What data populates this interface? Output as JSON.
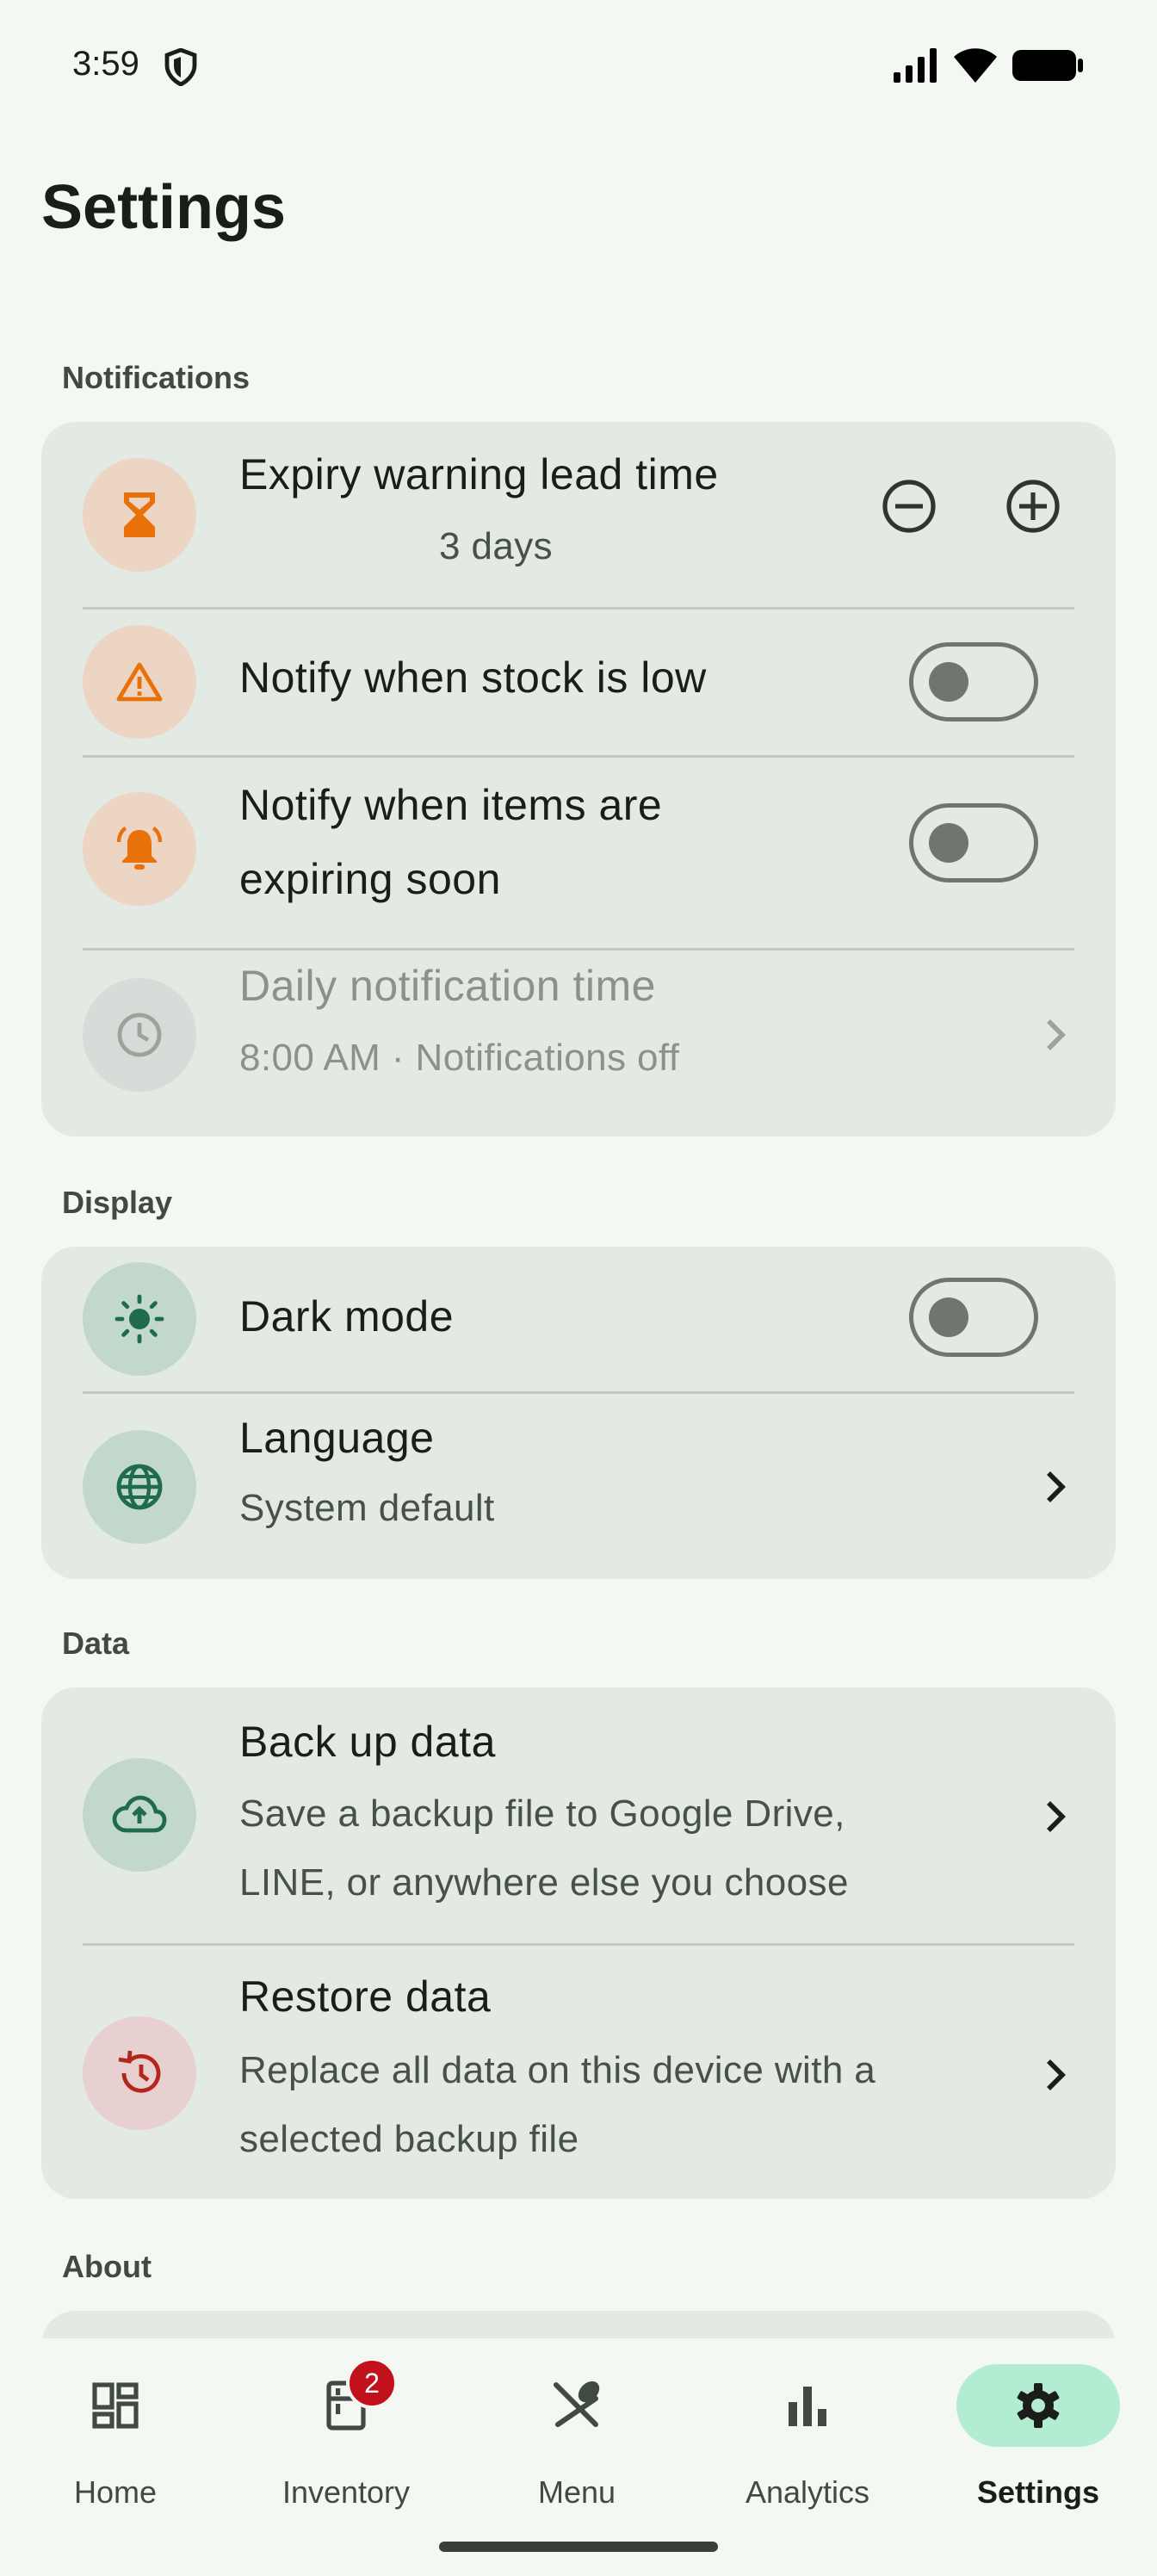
{
  "status": {
    "time": "3:59"
  },
  "page": {
    "title": "Settings"
  },
  "sections": {
    "notifications": {
      "label": "Notifications",
      "expiry": {
        "title": "Expiry warning lead time",
        "value": "3 days"
      },
      "low_stock": {
        "title": "Notify when stock is low",
        "enabled": false
      },
      "expiring": {
        "title_line1": "Notify when items are",
        "title_line2": "expiring soon",
        "enabled": false
      },
      "daily": {
        "title": "Daily notification time",
        "subtitle": "8:00 AM · Notifications off",
        "disabled": true
      }
    },
    "display": {
      "label": "Display",
      "dark_mode": {
        "title": "Dark mode",
        "enabled": false
      },
      "language": {
        "title": "Language",
        "subtitle": "System default"
      }
    },
    "data": {
      "label": "Data",
      "backup": {
        "title": "Back up data",
        "subtitle_line1": "Save a backup file to Google Drive,",
        "subtitle_line2": "LINE, or anywhere else you choose"
      },
      "restore": {
        "title": "Restore data",
        "subtitle_line1": "Replace all data on this device with a",
        "subtitle_line2": "selected backup file"
      }
    },
    "about": {
      "label": "About"
    }
  },
  "nav": {
    "items": [
      {
        "label": "Home",
        "icon": "dashboard-icon"
      },
      {
        "label": "Inventory",
        "icon": "fridge-icon",
        "badge": "2"
      },
      {
        "label": "Menu",
        "icon": "utensils-icon"
      },
      {
        "label": "Analytics",
        "icon": "bar-chart-icon"
      },
      {
        "label": "Settings",
        "icon": "gear-icon",
        "active": true
      }
    ]
  },
  "colors": {
    "accent_orange": "#e8710a",
    "accent_green": "#1f6b4e",
    "accent_red": "#b3261e",
    "active_pill": "#b3edd1"
  }
}
